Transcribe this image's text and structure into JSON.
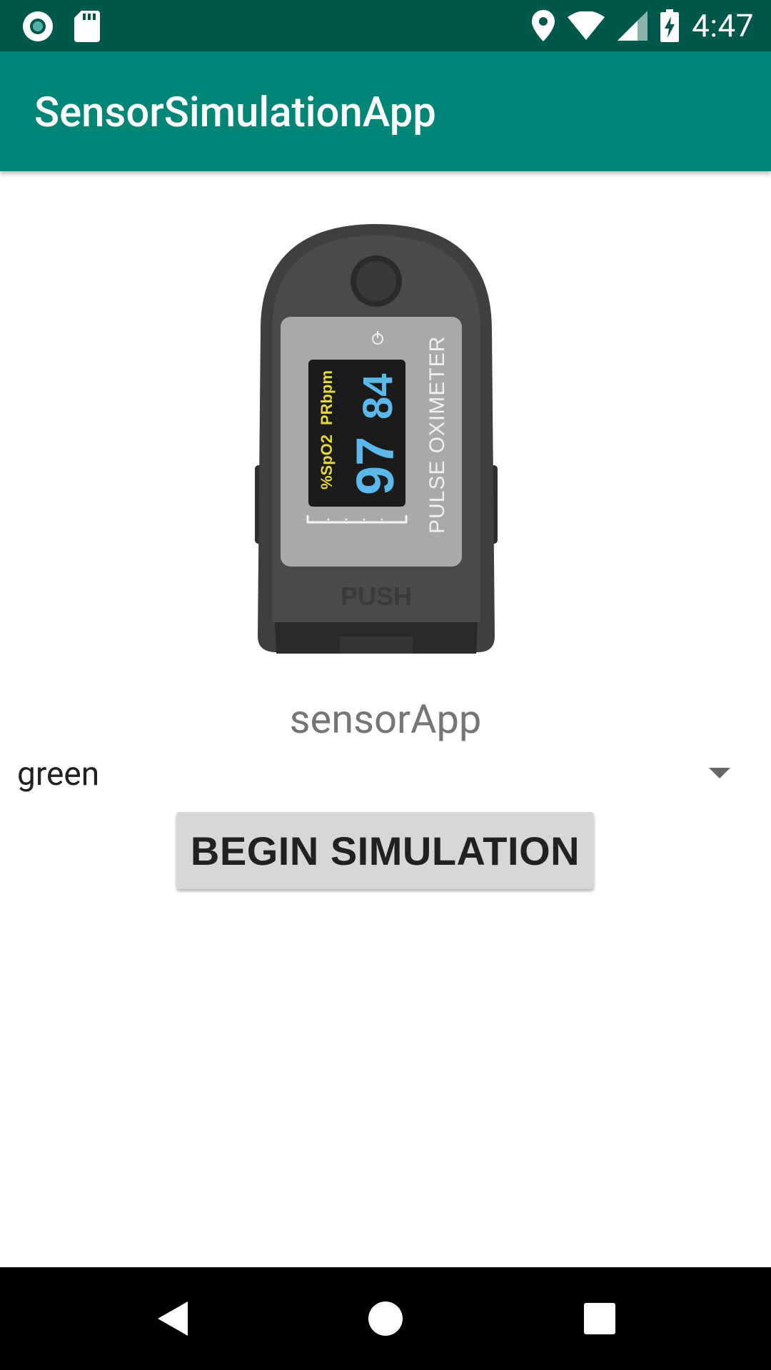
{
  "status_bar": {
    "time": "4:47",
    "icons": [
      "record-icon",
      "sd-card-icon",
      "location-icon",
      "wifi-icon",
      "signal-icon",
      "battery-charging-icon"
    ]
  },
  "app_bar": {
    "title": "SensorSimulationApp"
  },
  "device_image": {
    "spo2_label": "%SpO2",
    "pr_label": "PRbpm",
    "spo2_value": "97",
    "pr_value": "84",
    "brand_text": "PULSE OXIMETER",
    "push_text": "PUSH"
  },
  "main": {
    "label": "sensorApp",
    "spinner_selected": "green",
    "button_label": "BEGIN SIMULATION"
  },
  "nav_bar": {
    "icons": [
      "back-icon",
      "home-icon",
      "recents-icon"
    ]
  },
  "colors": {
    "status_bar": "#00574b",
    "app_bar": "#008577",
    "button_bg": "#d6d7d7",
    "display_blue": "#5bb8ea",
    "display_yellow": "#e6d83a"
  }
}
